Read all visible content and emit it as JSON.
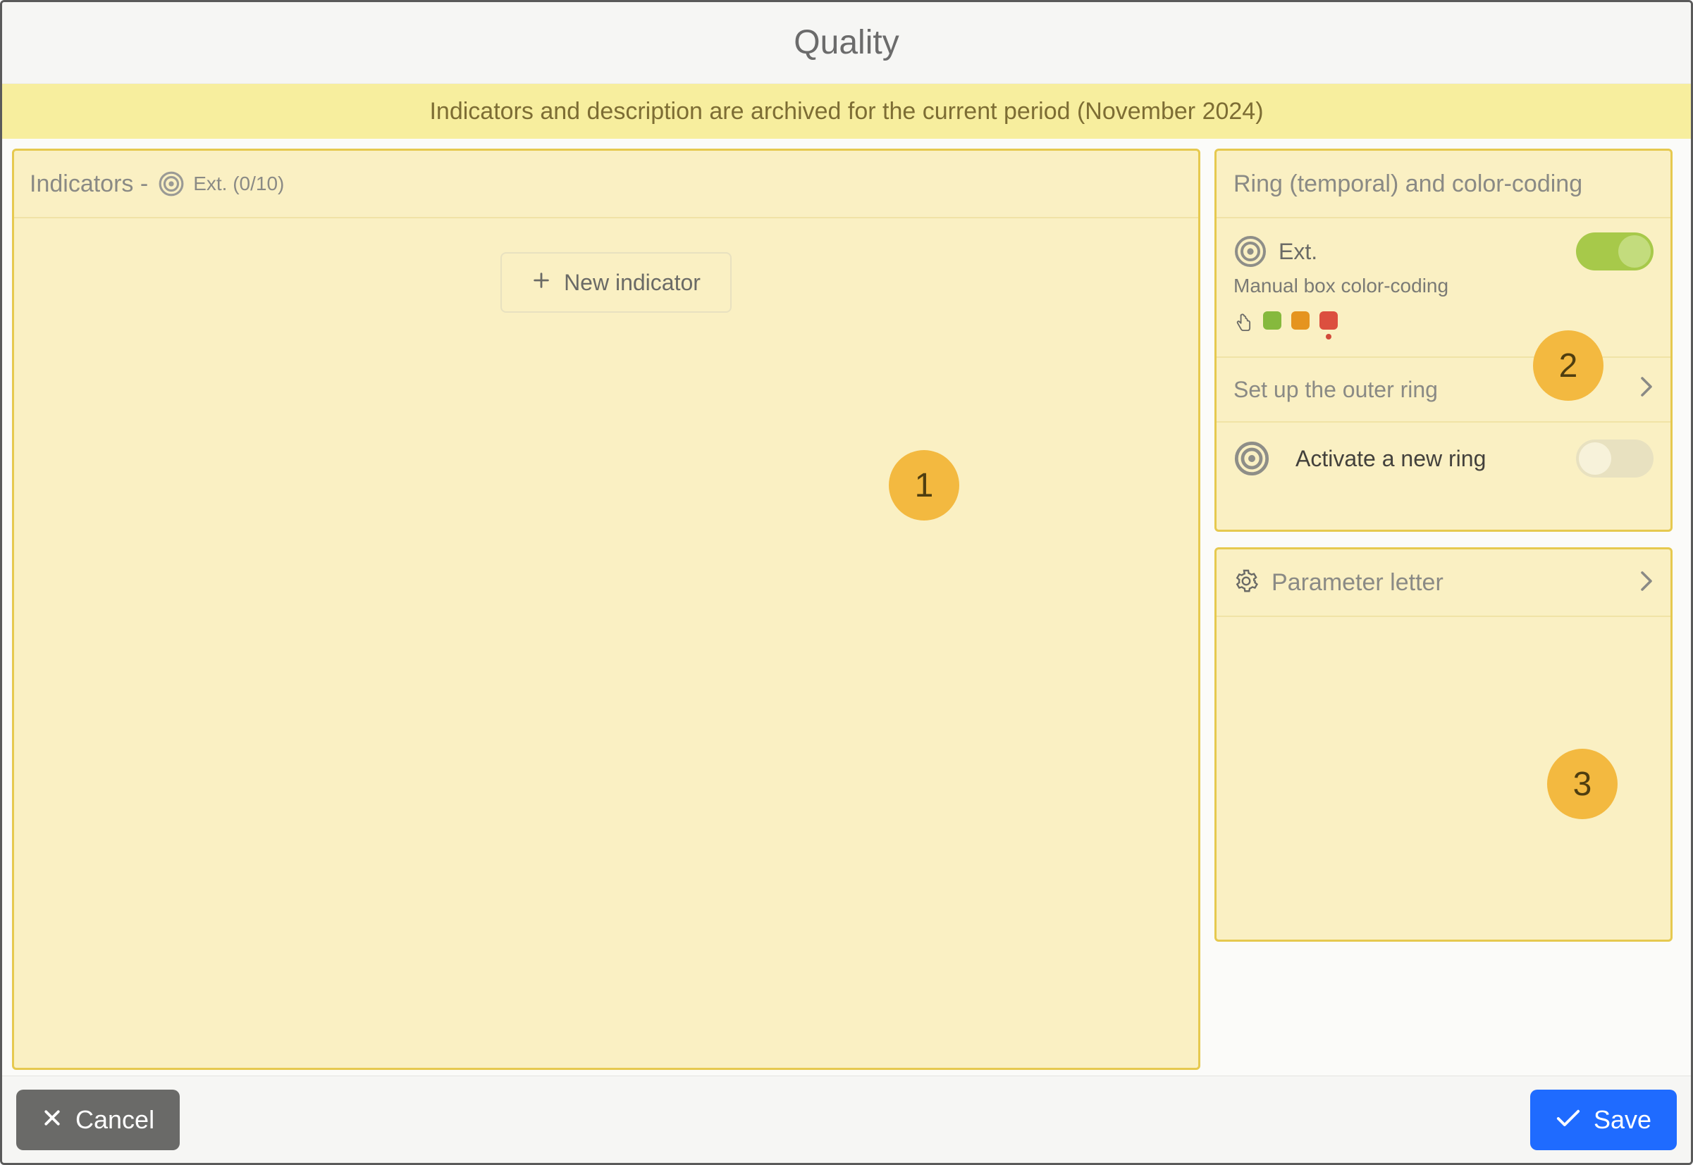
{
  "header": {
    "title": "Quality"
  },
  "banner": {
    "text": "Indicators and description are archived for the current period (November 2024)"
  },
  "indicators_panel": {
    "title_prefix": "Indicators -",
    "ext_label": "Ext. (0/10)",
    "new_indicator_label": "New indicator"
  },
  "ring_panel": {
    "title": "Ring (temporal) and color-coding",
    "ext_label": "Ext.",
    "ext_toggle_on": true,
    "manual_label": "Manual box color-coding",
    "swatches": [
      "#86b93d",
      "#e5941f",
      "#dc4f3f"
    ],
    "selected_swatch_index": 2,
    "setup_link": "Set up the outer ring",
    "activate_label": "Activate a new ring",
    "activate_toggle_on": false
  },
  "param_panel": {
    "title": "Parameter letter"
  },
  "callouts": {
    "c1": "1",
    "c2": "2",
    "c3": "3"
  },
  "footer": {
    "cancel_label": "Cancel",
    "save_label": "Save"
  }
}
